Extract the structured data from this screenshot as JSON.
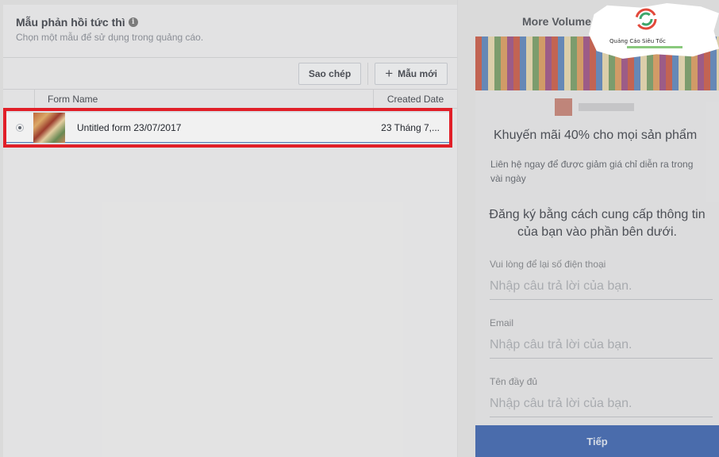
{
  "left_panel": {
    "title": "Mẫu phản hồi tức thì",
    "info_icon": "info-icon",
    "subtitle": "Chọn một mẫu để sử dụng trong quảng cáo.",
    "toolbar": {
      "copy_label": "Sao chép",
      "new_label": "Mẫu mới",
      "new_icon": "plus-icon"
    },
    "table": {
      "columns": [
        "Form Name",
        "Created Date"
      ],
      "rows": [
        {
          "name": "Untitled form 23/07/2017",
          "date": "23 Tháng 7,...",
          "selected": true
        }
      ]
    },
    "highlight_color": "#ee1c25"
  },
  "preview": {
    "title": "More Volume",
    "headline": "Khuyến mãi 40% cho mọi sản phẩm",
    "description": "Liên hệ ngay để được giảm giá chỉ diễn ra trong vài ngày",
    "prompt": "Đăng ký bằng cách cung cấp thông tin của bạn vào phần bên dưới.",
    "fields": [
      {
        "label": "Vui lòng để lại số điện thoại",
        "placeholder": "Nhập câu trả lời của bạn."
      },
      {
        "label": "Email",
        "placeholder": "Nhập câu trả lời của bạn."
      },
      {
        "label": "Tên đầy đủ",
        "placeholder": "Nhập câu trả lời của bạn."
      }
    ],
    "cta_label": "Tiếp",
    "cta_color": "#4a6fb5"
  },
  "watermark": {
    "text": "Quảng Cáo Siêu Tốc"
  }
}
